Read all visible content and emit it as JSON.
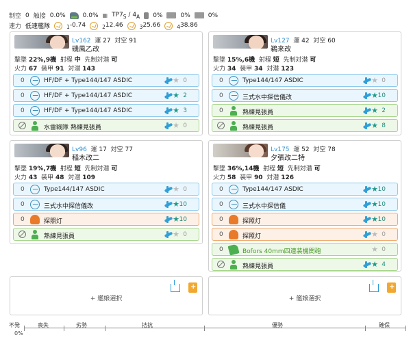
{
  "header": {
    "row1": {
      "control_label": "制空",
      "control_val": "0",
      "contact_label": "触接",
      "contact_val": "0.0%",
      "item1_val": "0.0%",
      "tp_label": "TP",
      "tp_s": "7",
      "tp_s_sub": "S",
      "tp_sep": "/",
      "tp_a": "4",
      "tp_a_sub": "A",
      "item2_val": "0%",
      "item3_val": "0%",
      "item4_val": "0%"
    },
    "row2": {
      "speed_label": "速力",
      "speed_val": "低速艦隊",
      "r1": "1",
      "r1_val": "-0.74",
      "r2": "2",
      "r2_val": "12.46",
      "r3": "3",
      "r3_val": "25.66",
      "r4": "4",
      "r4_val": "38.86"
    }
  },
  "labels": {
    "evasion": "擊墜",
    "range": "射程",
    "preemptive": "先制対潜",
    "firepower": "火力",
    "armor": "装甲",
    "asw": "対潜",
    "luck": "運",
    "aa": "対空",
    "lv_prefix": "Lv"
  },
  "ships": [
    {
      "lv": "162",
      "luck": "27",
      "aa": "91",
      "name": "磯風乙改",
      "shootdown": "22%,9機",
      "range": "中",
      "preemptive": "可",
      "firepower": "67",
      "armor": "91",
      "asw": "143",
      "slots": [
        {
          "count": "0",
          "name": "HF/DF + Type144/147 ASDIC",
          "stars": "0"
        },
        {
          "count": "0",
          "name": "HF/DF + Type144/147 ASDIC",
          "stars": "2"
        },
        {
          "count": "0",
          "name": "HF/DF + Type144/147 ASDIC",
          "stars": "3"
        },
        {
          "count": "",
          "name": "水雷戦隊 熟練見張員",
          "stars": "0"
        }
      ]
    },
    {
      "lv": "127",
      "luck": "42",
      "aa": "60",
      "name": "鵜来改",
      "shootdown": "15%,6機",
      "range": "短",
      "preemptive": "可",
      "firepower": "34",
      "armor": "34",
      "asw": "123",
      "slots": [
        {
          "count": "0",
          "name": "Type144/147 ASDIC",
          "stars": "0"
        },
        {
          "count": "0",
          "name": "三式水中探信儀改",
          "stars": "10"
        },
        {
          "count": "0",
          "name": "熟練見張員",
          "stars": "2"
        },
        {
          "count": "",
          "name": "熟練見張員",
          "stars": "8"
        }
      ]
    },
    {
      "lv": "96",
      "luck": "17",
      "aa": "77",
      "name": "稲木改二",
      "shootdown": "19%,7機",
      "range": "短",
      "preemptive": "可",
      "firepower": "43",
      "armor": "48",
      "asw": "109",
      "slots": [
        {
          "count": "0",
          "name": "Type144/147 ASDIC",
          "stars": "0"
        },
        {
          "count": "0",
          "name": "三式水中探信儀改",
          "stars": "10"
        },
        {
          "count": "0",
          "name": "探照灯",
          "stars": "10"
        },
        {
          "count": "",
          "name": "熟練見張員",
          "stars": "0"
        }
      ]
    },
    {
      "lv": "175",
      "luck": "52",
      "aa": "78",
      "name": "夕張改二特",
      "shootdown": "36%,14機",
      "range": "短",
      "preemptive": "可",
      "firepower": "58",
      "armor": "90",
      "asw": "126",
      "slots": [
        {
          "count": "0",
          "name": "Type144/147 ASDIC",
          "stars": "10"
        },
        {
          "count": "0",
          "name": "三式水中探信儀",
          "stars": "10"
        },
        {
          "count": "0",
          "name": "探照灯",
          "stars": "10"
        },
        {
          "count": "0",
          "name": "探照灯",
          "stars": "0"
        },
        {
          "count": "0",
          "name": "Bofors 40mm四連装機関砲",
          "stars": "0"
        },
        {
          "count": "",
          "name": "熟練見張員",
          "stars": "4"
        }
      ]
    }
  ],
  "empty_slots": [
    {
      "label": "+ 艦娘選択"
    },
    {
      "label": "+ 艦娘選択"
    }
  ],
  "bottom_bar": {
    "label": "不発",
    "percent": "0%",
    "segments": [
      "喪失",
      "劣勢",
      "拮抗",
      "優勢",
      "確保"
    ]
  },
  "colors": {
    "accent": "#2b8fd6",
    "sonar_slot_border": "#8cc9ec",
    "searchlight_slot_border": "#f0a86a",
    "lookout_slot_border": "#a6d58a",
    "star_on": "#1e9a8a"
  }
}
